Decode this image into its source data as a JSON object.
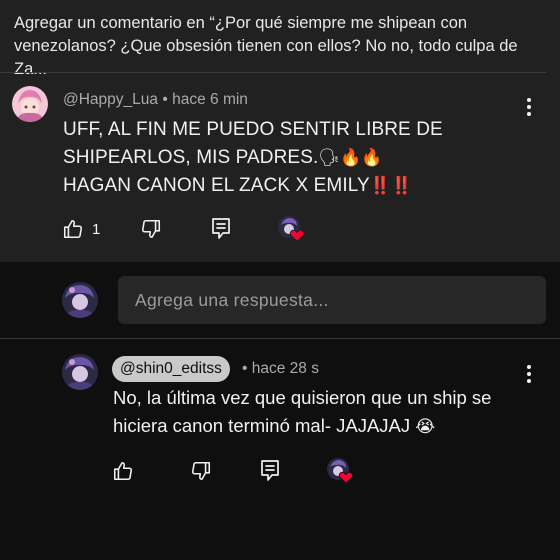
{
  "header": {
    "title": "Agregar un comentario en “¿Por qué siempre me shipean con venezolanos? ¿Que obsesión tienen con ellos? No no, todo culpa de Za..."
  },
  "comment": {
    "author": "@Happy_Lua",
    "separator": "•",
    "time": "hace 6 min",
    "lines": [
      "UFF, AL FIN ME PUEDO SENTIR LIBRE DE",
      "SHIPEARLOS, MIS PADRES.",
      "HAGAN CANON EL ZACK X EMILY"
    ],
    "line2_emojis": "🗣🔥🔥",
    "line3_emojis": "‼️‼️",
    "like_count": "1"
  },
  "reply_input": {
    "placeholder": "Agrega una respuesta..."
  },
  "reply": {
    "author": "@shin0_editss",
    "separator": "•",
    "time": "hace 28 s",
    "text_line1": "No, la última vez que quisieron que un ship se",
    "text_line2": "hiciera canon terminó mal- JAJAJAJ",
    "text_emoji": "😭"
  },
  "icons": {
    "like": "thumb-up-icon",
    "dislike": "thumb-down-icon",
    "reply": "reply-comment-icon",
    "heart": "creator-heart-icon",
    "more": "more-vert-icon"
  },
  "colors": {
    "background_top": "#212121",
    "background_bottom": "#0f0f0f",
    "heart": "#ff0033",
    "pill": "#c9c9c9"
  }
}
